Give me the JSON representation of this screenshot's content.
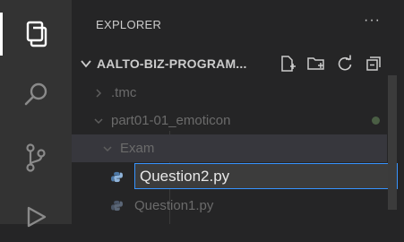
{
  "explorer": {
    "title": "EXPLORER",
    "more_label": "···",
    "section_title": "AALTO-BIZ-PROGRAM...",
    "actions": [
      "new-file-icon",
      "new-folder-icon",
      "refresh-icon",
      "collapse-all-icon"
    ]
  },
  "activity_bar": {
    "items": [
      "explorer-icon",
      "search-icon",
      "source-control-icon",
      "run-debug-icon"
    ],
    "active": "explorer-icon"
  },
  "tree": {
    "items": [
      {
        "label": ".tmc",
        "type": "folder",
        "expanded": false
      },
      {
        "label": "part01-01_emoticon",
        "type": "folder",
        "expanded": true
      },
      {
        "label": "Exam",
        "type": "folder",
        "expanded": true
      },
      {
        "label": "Question2.py",
        "type": "file",
        "renaming": true
      },
      {
        "label": "Question1.py",
        "type": "file"
      }
    ]
  },
  "colors": {
    "accent": "#3794ff",
    "python_icon": "#4e79a7",
    "modified_dot": "#4a5e44"
  }
}
